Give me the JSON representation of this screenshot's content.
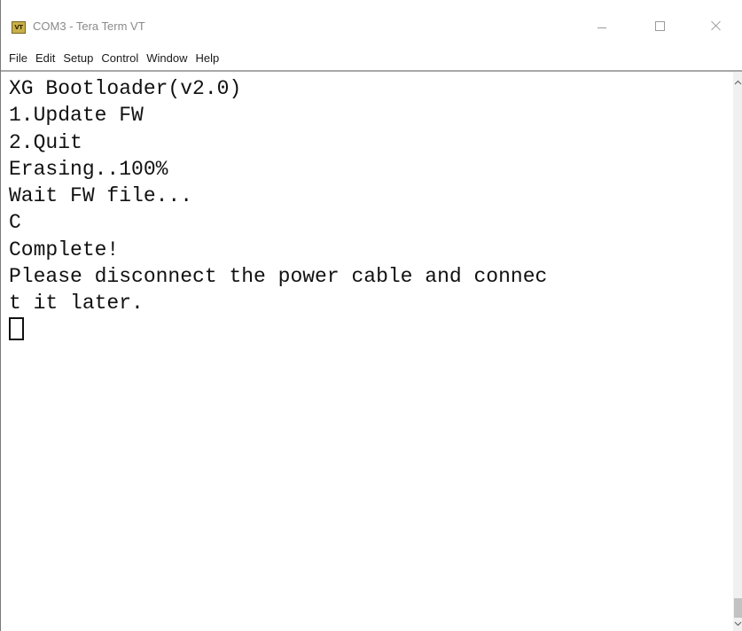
{
  "window": {
    "title": "COM3 - Tera Term VT",
    "icon_label": "VT",
    "icon_name": "teraterm-app-icon"
  },
  "menu": [
    "File",
    "Edit",
    "Setup",
    "Control",
    "Window",
    "Help"
  ],
  "terminal": {
    "lines": [
      "XG Bootloader(v2.0)",
      "1.Update FW",
      "2.Quit",
      "Erasing..100%",
      "Wait FW file...",
      "C",
      "Complete!",
      "Please disconnect the power cable and connec",
      "t it later."
    ]
  },
  "icons": {
    "minimize": "minimize-icon",
    "maximize": "maximize-icon",
    "close": "close-icon",
    "scroll_up": "chevron-up-icon",
    "scroll_down": "chevron-down-icon"
  },
  "colors": {
    "terminal_bg": "#ffffff",
    "terminal_fg": "#111111",
    "title_text": "#8a8a8a"
  }
}
